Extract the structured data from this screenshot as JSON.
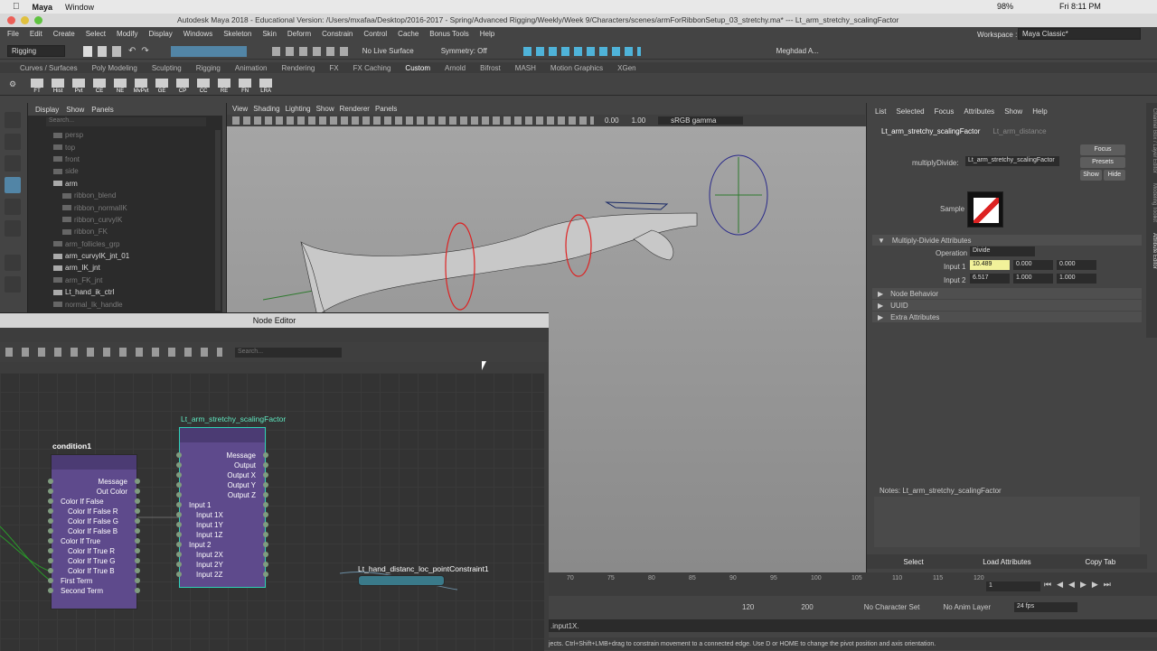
{
  "sysbar": {
    "app": "Maya",
    "menus": [
      "Window"
    ],
    "title": "Autodesk Maya 2018 - Educational Version: /Users/mxafaa/Desktop/2016-2017 - Spring/Advanced Rigging/Weekly/Week 9/Characters/scenes/armForRibbonSetup_03_stretchy.ma*  ---  Lt_arm_stretchy_scalingFactor",
    "battery": "98%",
    "clock": "Fri 8:11 PM"
  },
  "main_menu": [
    "File",
    "Edit",
    "Create",
    "Select",
    "Modify",
    "Display",
    "Windows",
    "Skeleton",
    "Skin",
    "Deform",
    "Constrain",
    "Control",
    "Cache",
    "Bonus Tools",
    "Help"
  ],
  "workspace": {
    "label": "Workspace :",
    "value": "Maya Classic*"
  },
  "toolbar": {
    "mode": "Rigging",
    "live_surface": "No Live Surface",
    "symmetry": "Symmetry: Off",
    "user": "Meghdad A..."
  },
  "shelf_tabs": [
    "Curves / Surfaces",
    "Poly Modeling",
    "Sculpting",
    "Rigging",
    "Animation",
    "Rendering",
    "FX",
    "FX Caching",
    "Custom",
    "Arnold",
    "Bifrost",
    "MASH",
    "Motion Graphics",
    "XGen"
  ],
  "active_shelf": "Custom",
  "shelf_icons": [
    "FT",
    "Hist",
    "Pvt",
    "CE",
    "NE",
    "MvPvt",
    "GE",
    "CP",
    "CC",
    "RE",
    "FN",
    "LRA"
  ],
  "outliner": {
    "menu": [
      "Display",
      "Show",
      "Panels"
    ],
    "search_placeholder": "Search...",
    "items": [
      {
        "label": "persp",
        "dim": true,
        "indent": 1
      },
      {
        "label": "top",
        "dim": true,
        "indent": 1
      },
      {
        "label": "front",
        "dim": true,
        "indent": 1
      },
      {
        "label": "side",
        "dim": true,
        "indent": 1
      },
      {
        "label": "arm",
        "dim": false,
        "indent": 1
      },
      {
        "label": "ribbon_blend",
        "dim": true,
        "indent": 2
      },
      {
        "label": "ribbon_normalIK",
        "dim": true,
        "indent": 2
      },
      {
        "label": "ribbon_curvyIK",
        "dim": true,
        "indent": 2
      },
      {
        "label": "ribbon_FK",
        "dim": true,
        "indent": 2
      },
      {
        "label": "arm_follicles_grp",
        "dim": true,
        "indent": 1
      },
      {
        "label": "arm_curvyIK_jnt_01",
        "dim": false,
        "indent": 1
      },
      {
        "label": "arm_IK_jnt",
        "dim": false,
        "indent": 1
      },
      {
        "label": "arm_FK_jnt",
        "dim": true,
        "indent": 1
      },
      {
        "label": "Lt_hand_ik_ctrl",
        "dim": false,
        "indent": 1
      },
      {
        "label": "normal_Ik_handle",
        "dim": true,
        "indent": 1
      }
    ]
  },
  "viewport": {
    "menu": [
      "View",
      "Shading",
      "Lighting",
      "Show",
      "Renderer",
      "Panels"
    ],
    "near": "0.00",
    "far": "1.00",
    "colorspace": "sRGB gamma"
  },
  "attr_editor": {
    "menu": [
      "List",
      "Selected",
      "Focus",
      "Attributes",
      "Show",
      "Help"
    ],
    "tabs": [
      "Lt_arm_stretchy_scalingFactor",
      "Lt_arm_distance"
    ],
    "node_type_label": "multiplyDivide:",
    "node_name": "Lt_arm_stretchy_scalingFactor",
    "focus": "Focus",
    "presets": "Presets",
    "show": "Show",
    "hide": "Hide",
    "sample": "Sample",
    "section_main": "Multiply-Divide Attributes",
    "operation_label": "Operation",
    "operation": "Divide",
    "input1_label": "Input 1",
    "input1": [
      "10.489",
      "0.000",
      "0.000"
    ],
    "input2_label": "Input 2",
    "input2": [
      "6.517",
      "1.000",
      "1.000"
    ],
    "sections": [
      "Node Behavior",
      "UUID",
      "Extra Attributes"
    ],
    "notes": "Notes:  Lt_arm_stretchy_scalingFactor",
    "bottom_buttons": [
      "Select",
      "Load Attributes",
      "Copy Tab"
    ],
    "side_tabs": [
      "Channel Box / Layer Editor",
      "Modeling Toolkit",
      "Attribute Editor"
    ]
  },
  "node_editor": {
    "title": "Node Editor",
    "search_placeholder": "Search...",
    "nodes": {
      "condition": {
        "title": "condition1",
        "attrs": [
          "Message",
          "Out Color",
          "Color If False",
          "Color If False R",
          "Color If False G",
          "Color If False B",
          "Color If True",
          "Color If True R",
          "Color If True G",
          "Color If True B",
          "First Term",
          "Second Term"
        ]
      },
      "scaling": {
        "title": "Lt_arm_stretchy_scalingFactor",
        "attrs": [
          "Message",
          "Output",
          "Output X",
          "Output Y",
          "Output Z",
          "Input 1",
          "Input 1X",
          "Input 1Y",
          "Input 1Z",
          "Input 2",
          "Input 2X",
          "Input 2Y",
          "Input 2Z"
        ]
      },
      "constraint": {
        "title": "Lt_hand_distanc_loc_pointConstraint1"
      }
    }
  },
  "timeline": {
    "ticks": [
      "70",
      "75",
      "80",
      "85",
      "90",
      "95",
      "100",
      "105",
      "110",
      "115",
      "120"
    ],
    "current_frame": "1",
    "range_end": "120",
    "anim_end": "200",
    "char_set": "No Character Set",
    "anim_layer": "No Anim Layer",
    "fps": "24 fps"
  },
  "command_line": ".input1X.",
  "help_line": "jects. Ctrl+Shift+LMB+drag to constrain movement to a connected edge. Use D or HOME to change the pivot position and axis orientation.",
  "colors": {
    "accent": "#5285a6",
    "node_purple": "#5e4a8c",
    "node_highlight": "#2fd1b5",
    "input_highlight": "#f2f29a"
  }
}
